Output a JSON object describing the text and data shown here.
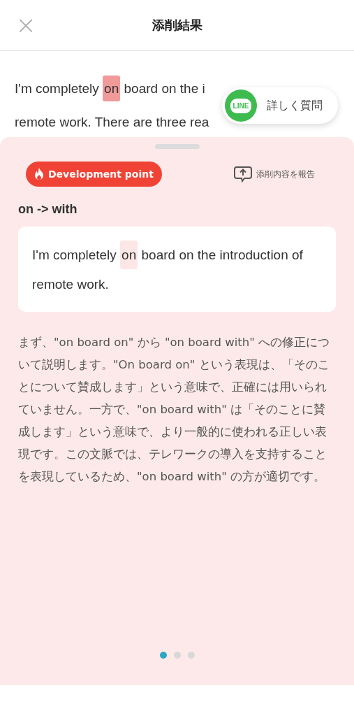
{
  "header": {
    "close": "×",
    "title": "添削結果"
  },
  "essay": {
    "lines": [
      [
        {
          "text": "I'm completely ",
          "highlight": false
        },
        {
          "text": "on",
          "highlight": true
        },
        {
          "text": " board on the i",
          "highlight": false
        }
      ],
      [
        {
          "text": "remote work. There are three rea",
          "highlight": false
        }
      ]
    ]
  },
  "ask_button": {
    "badge": "LINE",
    "label": "詳しく質問"
  },
  "sheet": {
    "tag": "Development point",
    "report": "添削内容を報告",
    "correction": "on -> with",
    "example": [
      {
        "text": "I'm completely ",
        "highlight": false
      },
      {
        "text": "on",
        "highlight": true
      },
      {
        "text": " board on the introduction of remote work.",
        "highlight": false
      }
    ],
    "explanation": "まず、\"on board on\" から \"on board with\" への修正について説明します。\"On board on\" という表現は、「そのことについて賛成します」という意味で、正確には用いられていません。一方で、\"on board with\" は「そのことに賛成します」という意味で、より一般的に使われる正しい表現です。この文脈では、テレワークの導入を支持することを表現しているため、\"on board with\" の方が適切です。",
    "pages": [
      {
        "selected": true
      },
      {
        "selected": false
      },
      {
        "selected": false
      }
    ]
  }
}
